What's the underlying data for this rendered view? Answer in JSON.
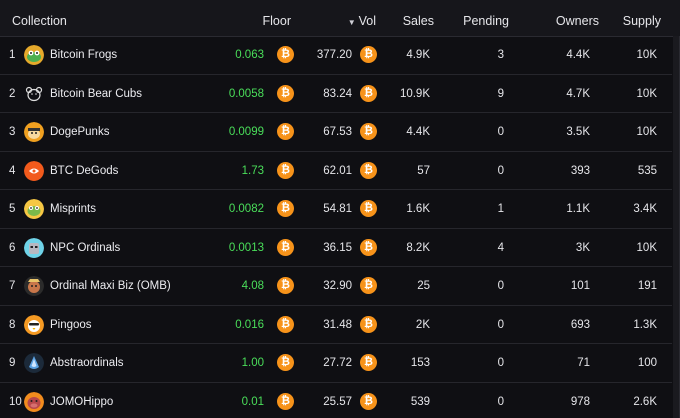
{
  "header": {
    "collection": "Collection",
    "floor": "Floor",
    "vol": "Vol",
    "vol_sort_icon": "▼",
    "sales": "Sales",
    "pending": "Pending",
    "owners": "Owners",
    "supply": "Supply"
  },
  "icons": {
    "bitcoin": "₿"
  },
  "colors": {
    "floor_green": "#4ade5a",
    "btc_orange": "#f7931a",
    "background": "#0f0f13"
  },
  "rows": [
    {
      "rank": "1",
      "name": "Bitcoin Frogs",
      "floor": "0.063",
      "vol": "377.20",
      "sales": "4.9K",
      "pending": "3",
      "owners": "4.4K",
      "supply": "10K"
    },
    {
      "rank": "2",
      "name": "Bitcoin Bear Cubs",
      "floor": "0.0058",
      "vol": "83.24",
      "sales": "10.9K",
      "pending": "9",
      "owners": "4.7K",
      "supply": "10K"
    },
    {
      "rank": "3",
      "name": "DogePunks",
      "floor": "0.0099",
      "vol": "67.53",
      "sales": "4.4K",
      "pending": "0",
      "owners": "3.5K",
      "supply": "10K"
    },
    {
      "rank": "4",
      "name": "BTC DeGods",
      "floor": "1.73",
      "vol": "62.01",
      "sales": "57",
      "pending": "0",
      "owners": "393",
      "supply": "535"
    },
    {
      "rank": "5",
      "name": "Misprints",
      "floor": "0.0082",
      "vol": "54.81",
      "sales": "1.6K",
      "pending": "1",
      "owners": "1.1K",
      "supply": "3.4K"
    },
    {
      "rank": "6",
      "name": "NPC Ordinals",
      "floor": "0.0013",
      "vol": "36.15",
      "sales": "8.2K",
      "pending": "4",
      "owners": "3K",
      "supply": "10K"
    },
    {
      "rank": "7",
      "name": "Ordinal Maxi Biz (OMB)",
      "floor": "4.08",
      "vol": "32.90",
      "sales": "25",
      "pending": "0",
      "owners": "101",
      "supply": "191"
    },
    {
      "rank": "8",
      "name": "Pingoos",
      "floor": "0.016",
      "vol": "31.48",
      "sales": "2K",
      "pending": "0",
      "owners": "693",
      "supply": "1.3K"
    },
    {
      "rank": "9",
      "name": "Abstraordinals",
      "floor": "1.00",
      "vol": "27.72",
      "sales": "153",
      "pending": "0",
      "owners": "71",
      "supply": "100"
    },
    {
      "rank": "10",
      "name": "JOMOHippo",
      "floor": "0.01",
      "vol": "25.57",
      "sales": "539",
      "pending": "0",
      "owners": "978",
      "supply": "2.6K"
    }
  ]
}
